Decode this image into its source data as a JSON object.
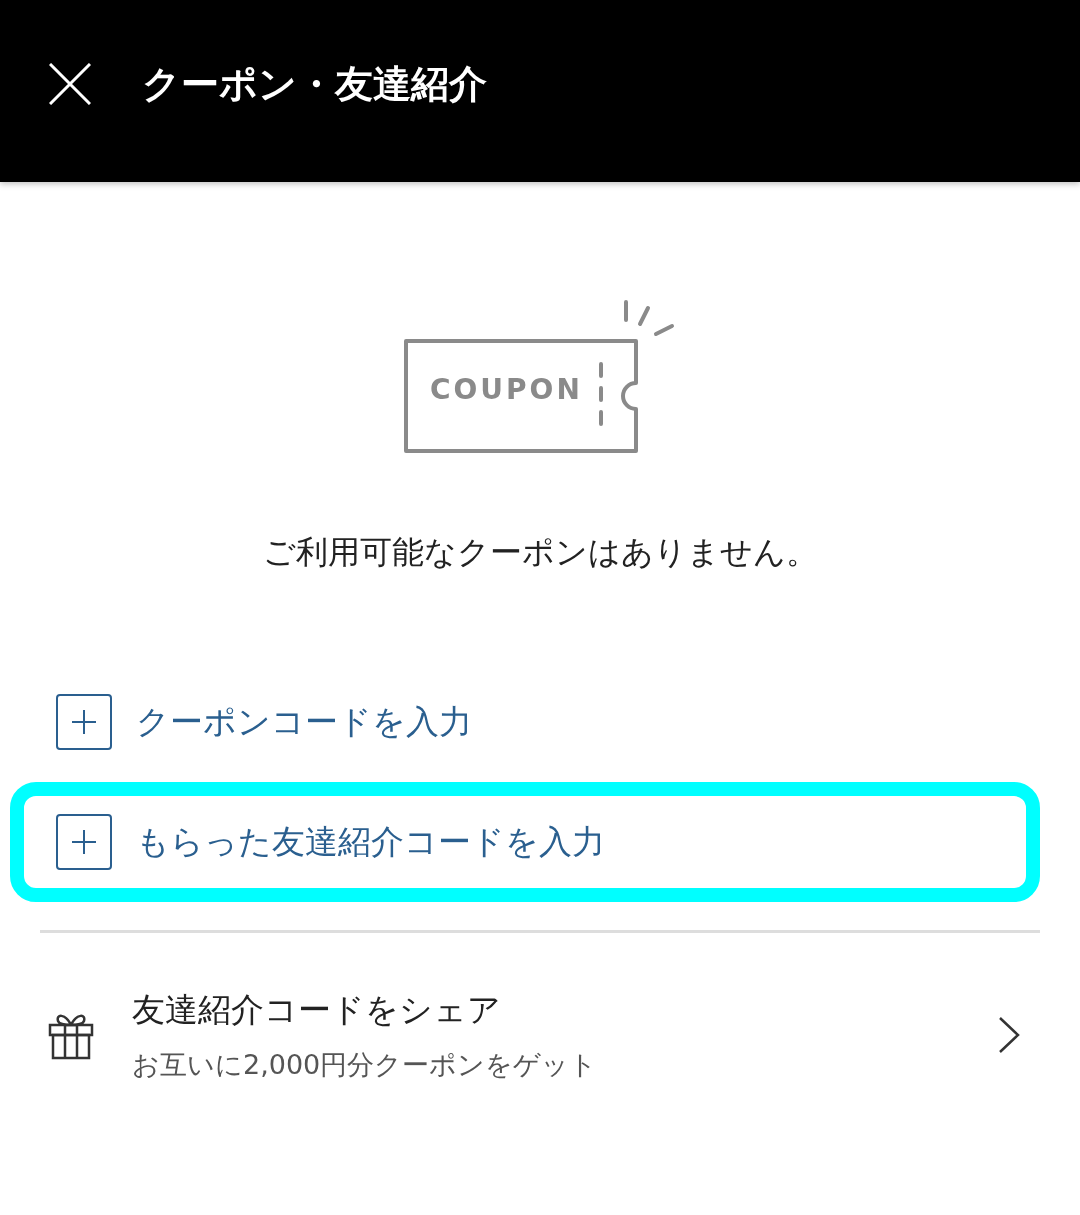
{
  "header": {
    "title": "クーポン・友達紹介"
  },
  "empty_state": {
    "illustration_label": "COUPON",
    "message": "ご利用可能なクーポンはありません。"
  },
  "actions": [
    {
      "label": "クーポンコードを入力",
      "highlighted": false
    },
    {
      "label": "もらった友達紹介コードを入力",
      "highlighted": true
    }
  ],
  "share": {
    "title": "友達紹介コードをシェア",
    "subtitle": "お互いに2,000円分クーポンをゲット"
  }
}
